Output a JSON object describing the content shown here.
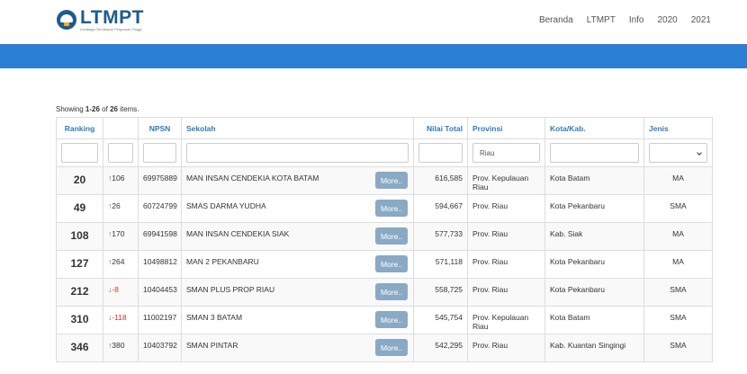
{
  "header": {
    "logo_word": "LTMPT",
    "logo_tagline": "Lembaga Tes Masuk Perguruan Tinggi",
    "nav": [
      "Beranda",
      "LTMPT",
      "Info",
      "2020",
      "2021"
    ]
  },
  "summary": {
    "prefix": "Showing ",
    "range": "1-26",
    "middle": " of ",
    "total": "26",
    "suffix": " items."
  },
  "columns": {
    "ranking": "Ranking",
    "delta": "",
    "npsn": "NPSN",
    "sekolah": "Sekolah",
    "nilai": "Nilai Total",
    "provinsi": "Provinsi",
    "kota": "Kota/Kab.",
    "jenis": "Jenis"
  },
  "filters": {
    "provinsi": "Riau"
  },
  "more_label": "More..",
  "rows": [
    {
      "rank": "20",
      "dir": "up",
      "delta": "106",
      "npsn": "69975889",
      "sekolah": "MAN INSAN CENDEKIA KOTA BATAM",
      "nilai": "616,585",
      "provinsi": "Prov. Kepulauan Riau",
      "kota": "Kota Batam",
      "jenis": "MA"
    },
    {
      "rank": "49",
      "dir": "up",
      "delta": "26",
      "npsn": "60724799",
      "sekolah": "SMAS DARMA YUDHA",
      "nilai": "594,667",
      "provinsi": "Prov. Riau",
      "kota": "Kota Pekanbaru",
      "jenis": "SMA"
    },
    {
      "rank": "108",
      "dir": "up",
      "delta": "170",
      "npsn": "69941598",
      "sekolah": "MAN INSAN CENDEKIA SIAK",
      "nilai": "577,733",
      "provinsi": "Prov. Riau",
      "kota": "Kab. Siak",
      "jenis": "MA"
    },
    {
      "rank": "127",
      "dir": "up",
      "delta": "264",
      "npsn": "10498812",
      "sekolah": "MAN 2 PEKANBARU",
      "nilai": "571,118",
      "provinsi": "Prov. Riau",
      "kota": "Kota Pekanbaru",
      "jenis": "MA"
    },
    {
      "rank": "212",
      "dir": "down",
      "delta": "-8",
      "npsn": "10404453",
      "sekolah": "SMAN PLUS PROP RIAU",
      "nilai": "558,725",
      "provinsi": "Prov. Riau",
      "kota": "Kota Pekanbaru",
      "jenis": "SMA"
    },
    {
      "rank": "310",
      "dir": "down",
      "delta": "-118",
      "npsn": "11002197",
      "sekolah": "SMAN 3 BATAM",
      "nilai": "545,754",
      "provinsi": "Prov. Kepulauan Riau",
      "kota": "Kota Batam",
      "jenis": "SMA"
    },
    {
      "rank": "346",
      "dir": "up",
      "delta": "380",
      "npsn": "10403792",
      "sekolah": "SMAN PINTAR",
      "nilai": "542,295",
      "provinsi": "Prov. Riau",
      "kota": "Kab. Kuantan Singingi",
      "jenis": "SMA"
    }
  ],
  "colors": {
    "brand": "#1e5a8e",
    "bar": "#2a7ed3",
    "link": "#337ab7",
    "more_button": "#8aa9c4",
    "up": "#2a8a2a",
    "down": "#d9302c"
  }
}
